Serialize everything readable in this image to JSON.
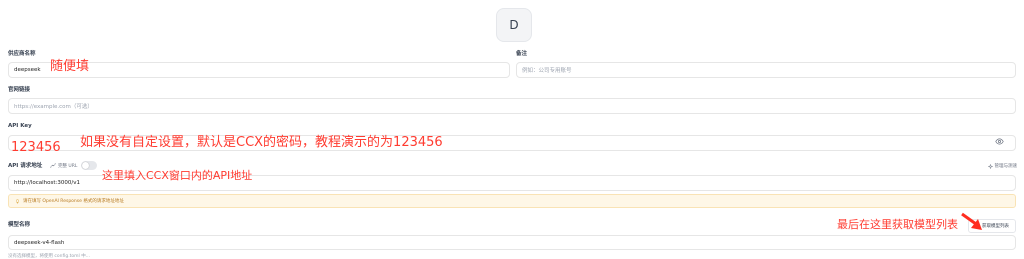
{
  "avatar": {
    "letter": "D"
  },
  "provider": {
    "label": "供应商名称",
    "value": "deepseek"
  },
  "note": {
    "label": "备注",
    "placeholder": "例如：公司专用账号"
  },
  "website": {
    "label": "官网链接",
    "placeholder": "https://example.com（可选）"
  },
  "api_key": {
    "label": "API Key",
    "value": "123456"
  },
  "endpoint": {
    "label": "API 请求地址",
    "full_url_label": "完整 URL",
    "manage_label": "管理与测速",
    "value": "http://localhost:3000/v1"
  },
  "warning": {
    "text": "请在填写 OpenAI Response 格式的请求地址地址"
  },
  "model": {
    "label": "模型名称",
    "value": "deepseek-v4-flash",
    "fetch_button": "获取模型列表",
    "hint": "没有选择模型，将使用 config.toml 中..."
  },
  "annotations": {
    "provider_note": "随便填",
    "apikey_note": "如果没有自定设置，默认是CCX的密码，教程演示的为123456",
    "endpoint_note": "这里填入CCX窗口内的API地址",
    "fetch_note": "最后在这里获取模型列表"
  },
  "colors": {
    "annotation": "#ff3b30",
    "warning_bg": "#fef7e7",
    "warning_text": "#b7791f"
  }
}
